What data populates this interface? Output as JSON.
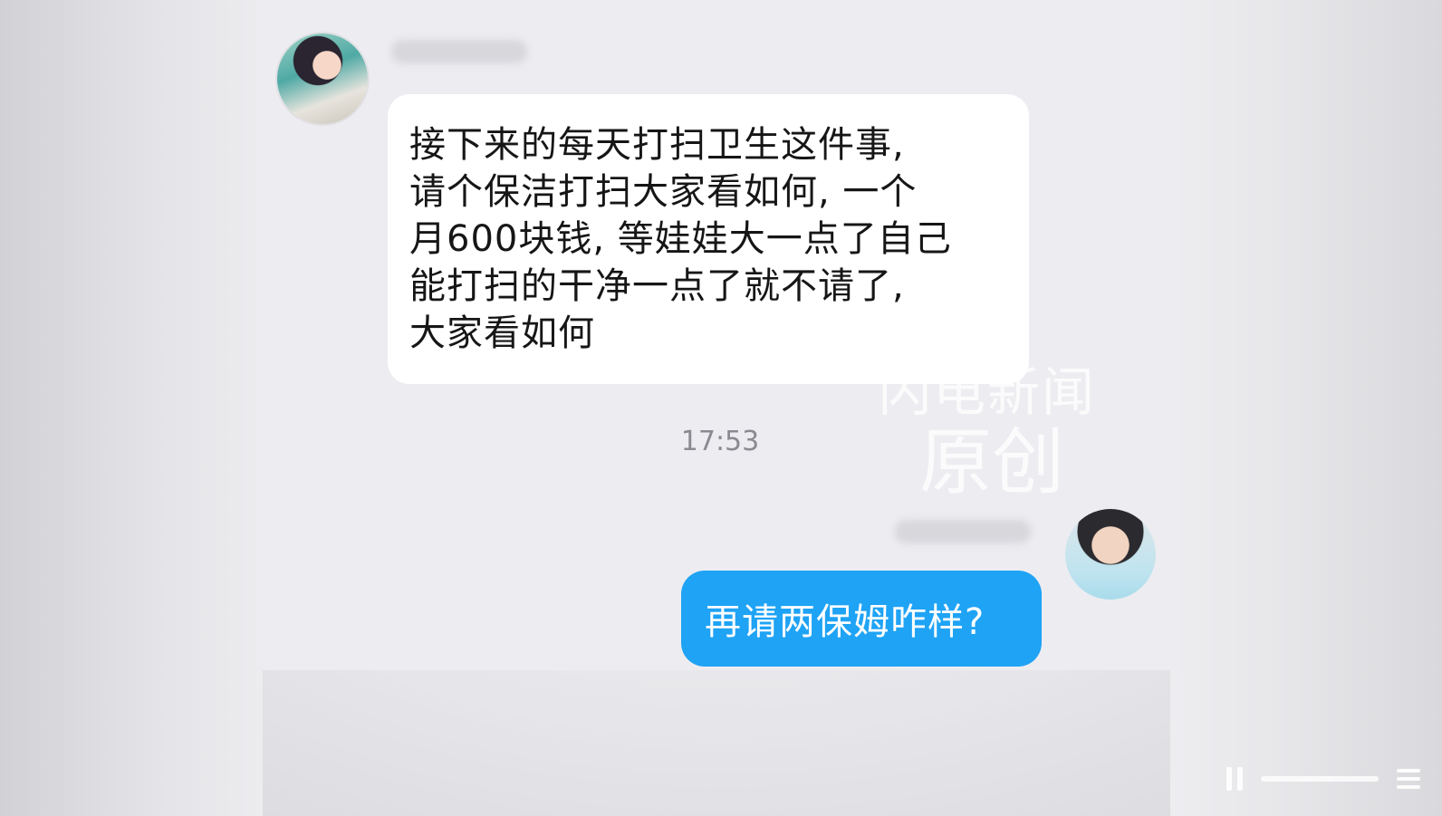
{
  "conversation": {
    "incoming": {
      "lines": [
        "接下来的每天打扫卫生这件事,",
        "请个保洁打扫大家看如何, 一个",
        "月600块钱, 等娃娃大一点了自己",
        "能打扫的干净一点了就不请了,",
        "大家看如何"
      ]
    },
    "timestamp": "17:53",
    "outgoing": {
      "text": "再请两保姆咋样?"
    }
  },
  "watermark": {
    "line1": "闪电新闻",
    "line2": "原创"
  },
  "colors": {
    "chat_background": "#ededf1",
    "incoming_bubble": "#ffffff",
    "outgoing_bubble": "#1fa3f5",
    "timestamp_text": "#8a8a90"
  },
  "icons": [
    "avatar",
    "media-controls-icon"
  ]
}
